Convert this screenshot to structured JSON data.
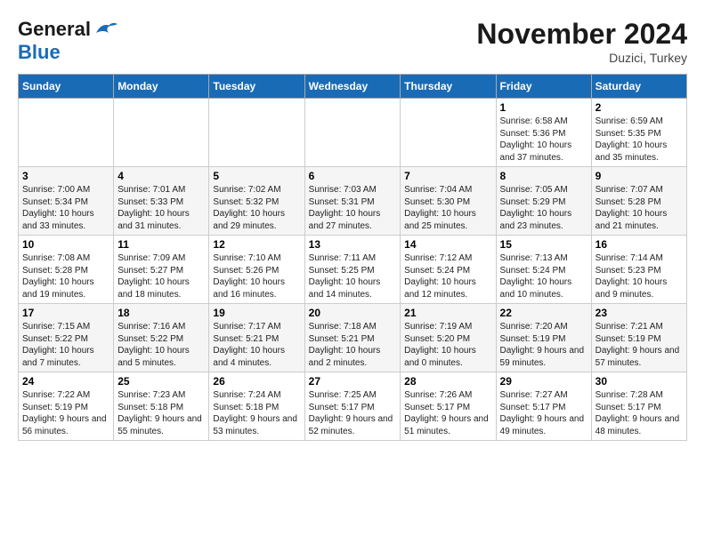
{
  "logo": {
    "line1": "General",
    "line2": "Blue"
  },
  "header": {
    "month": "November 2024",
    "location": "Duzici, Turkey"
  },
  "weekdays": [
    "Sunday",
    "Monday",
    "Tuesday",
    "Wednesday",
    "Thursday",
    "Friday",
    "Saturday"
  ],
  "weeks": [
    [
      {
        "day": "",
        "info": ""
      },
      {
        "day": "",
        "info": ""
      },
      {
        "day": "",
        "info": ""
      },
      {
        "day": "",
        "info": ""
      },
      {
        "day": "",
        "info": ""
      },
      {
        "day": "1",
        "info": "Sunrise: 6:58 AM\nSunset: 5:36 PM\nDaylight: 10 hours and 37 minutes."
      },
      {
        "day": "2",
        "info": "Sunrise: 6:59 AM\nSunset: 5:35 PM\nDaylight: 10 hours and 35 minutes."
      }
    ],
    [
      {
        "day": "3",
        "info": "Sunrise: 7:00 AM\nSunset: 5:34 PM\nDaylight: 10 hours and 33 minutes."
      },
      {
        "day": "4",
        "info": "Sunrise: 7:01 AM\nSunset: 5:33 PM\nDaylight: 10 hours and 31 minutes."
      },
      {
        "day": "5",
        "info": "Sunrise: 7:02 AM\nSunset: 5:32 PM\nDaylight: 10 hours and 29 minutes."
      },
      {
        "day": "6",
        "info": "Sunrise: 7:03 AM\nSunset: 5:31 PM\nDaylight: 10 hours and 27 minutes."
      },
      {
        "day": "7",
        "info": "Sunrise: 7:04 AM\nSunset: 5:30 PM\nDaylight: 10 hours and 25 minutes."
      },
      {
        "day": "8",
        "info": "Sunrise: 7:05 AM\nSunset: 5:29 PM\nDaylight: 10 hours and 23 minutes."
      },
      {
        "day": "9",
        "info": "Sunrise: 7:07 AM\nSunset: 5:28 PM\nDaylight: 10 hours and 21 minutes."
      }
    ],
    [
      {
        "day": "10",
        "info": "Sunrise: 7:08 AM\nSunset: 5:28 PM\nDaylight: 10 hours and 19 minutes."
      },
      {
        "day": "11",
        "info": "Sunrise: 7:09 AM\nSunset: 5:27 PM\nDaylight: 10 hours and 18 minutes."
      },
      {
        "day": "12",
        "info": "Sunrise: 7:10 AM\nSunset: 5:26 PM\nDaylight: 10 hours and 16 minutes."
      },
      {
        "day": "13",
        "info": "Sunrise: 7:11 AM\nSunset: 5:25 PM\nDaylight: 10 hours and 14 minutes."
      },
      {
        "day": "14",
        "info": "Sunrise: 7:12 AM\nSunset: 5:24 PM\nDaylight: 10 hours and 12 minutes."
      },
      {
        "day": "15",
        "info": "Sunrise: 7:13 AM\nSunset: 5:24 PM\nDaylight: 10 hours and 10 minutes."
      },
      {
        "day": "16",
        "info": "Sunrise: 7:14 AM\nSunset: 5:23 PM\nDaylight: 10 hours and 9 minutes."
      }
    ],
    [
      {
        "day": "17",
        "info": "Sunrise: 7:15 AM\nSunset: 5:22 PM\nDaylight: 10 hours and 7 minutes."
      },
      {
        "day": "18",
        "info": "Sunrise: 7:16 AM\nSunset: 5:22 PM\nDaylight: 10 hours and 5 minutes."
      },
      {
        "day": "19",
        "info": "Sunrise: 7:17 AM\nSunset: 5:21 PM\nDaylight: 10 hours and 4 minutes."
      },
      {
        "day": "20",
        "info": "Sunrise: 7:18 AM\nSunset: 5:21 PM\nDaylight: 10 hours and 2 minutes."
      },
      {
        "day": "21",
        "info": "Sunrise: 7:19 AM\nSunset: 5:20 PM\nDaylight: 10 hours and 0 minutes."
      },
      {
        "day": "22",
        "info": "Sunrise: 7:20 AM\nSunset: 5:19 PM\nDaylight: 9 hours and 59 minutes."
      },
      {
        "day": "23",
        "info": "Sunrise: 7:21 AM\nSunset: 5:19 PM\nDaylight: 9 hours and 57 minutes."
      }
    ],
    [
      {
        "day": "24",
        "info": "Sunrise: 7:22 AM\nSunset: 5:19 PM\nDaylight: 9 hours and 56 minutes."
      },
      {
        "day": "25",
        "info": "Sunrise: 7:23 AM\nSunset: 5:18 PM\nDaylight: 9 hours and 55 minutes."
      },
      {
        "day": "26",
        "info": "Sunrise: 7:24 AM\nSunset: 5:18 PM\nDaylight: 9 hours and 53 minutes."
      },
      {
        "day": "27",
        "info": "Sunrise: 7:25 AM\nSunset: 5:17 PM\nDaylight: 9 hours and 52 minutes."
      },
      {
        "day": "28",
        "info": "Sunrise: 7:26 AM\nSunset: 5:17 PM\nDaylight: 9 hours and 51 minutes."
      },
      {
        "day": "29",
        "info": "Sunrise: 7:27 AM\nSunset: 5:17 PM\nDaylight: 9 hours and 49 minutes."
      },
      {
        "day": "30",
        "info": "Sunrise: 7:28 AM\nSunset: 5:17 PM\nDaylight: 9 hours and 48 minutes."
      }
    ]
  ]
}
